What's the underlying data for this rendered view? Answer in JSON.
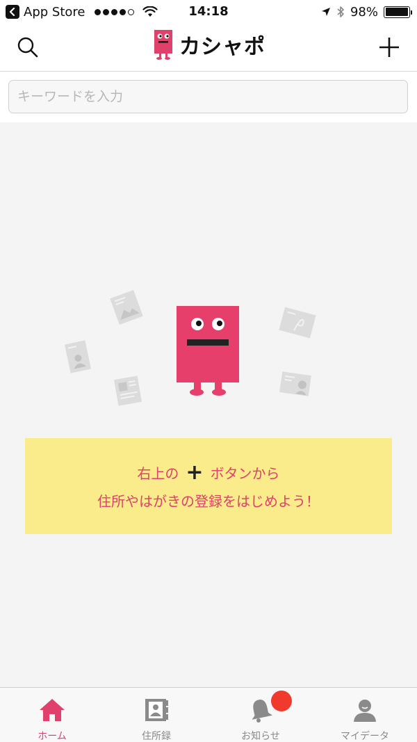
{
  "status_bar": {
    "back_app": "App Store",
    "time": "14:18",
    "battery": "98%",
    "battery_level": 0.98,
    "icons": [
      "back-arrow-icon",
      "signal-dots-icon",
      "wifi-icon",
      "location-arrow-icon",
      "bluetooth-icon",
      "battery-icon"
    ]
  },
  "nav": {
    "logo_text": "カシャポ",
    "icons": [
      "search-icon",
      "logo-mascot-icon",
      "plus-icon"
    ]
  },
  "search": {
    "placeholder": "キーワードを入力",
    "value": ""
  },
  "illustration": {
    "icons": [
      "mascot-icon",
      "postcard-image-icon",
      "postcard-portrait-icon",
      "postcard-layout-icon",
      "postcard-letter-icon",
      "postcard-profile-icon"
    ]
  },
  "banner": {
    "line1_prefix": "右上の",
    "line1_symbol": "+",
    "line1_suffix": "ボタンから",
    "line2": "住所やはがきの登録をはじめよう！"
  },
  "tabs": [
    {
      "label": "ホーム",
      "icon": "home-icon",
      "active": true
    },
    {
      "label": "住所録",
      "icon": "address-book-icon",
      "active": false
    },
    {
      "label": "お知らせ",
      "icon": "bell-icon",
      "active": false
    },
    {
      "label": "マイデータ",
      "icon": "user-icon",
      "active": false
    }
  ],
  "colors": {
    "brand_pink": "#e0406c",
    "banner_yellow": "#faeb8b",
    "notification_red": "#f03a2e",
    "inactive_gray": "#8a8a8a"
  }
}
